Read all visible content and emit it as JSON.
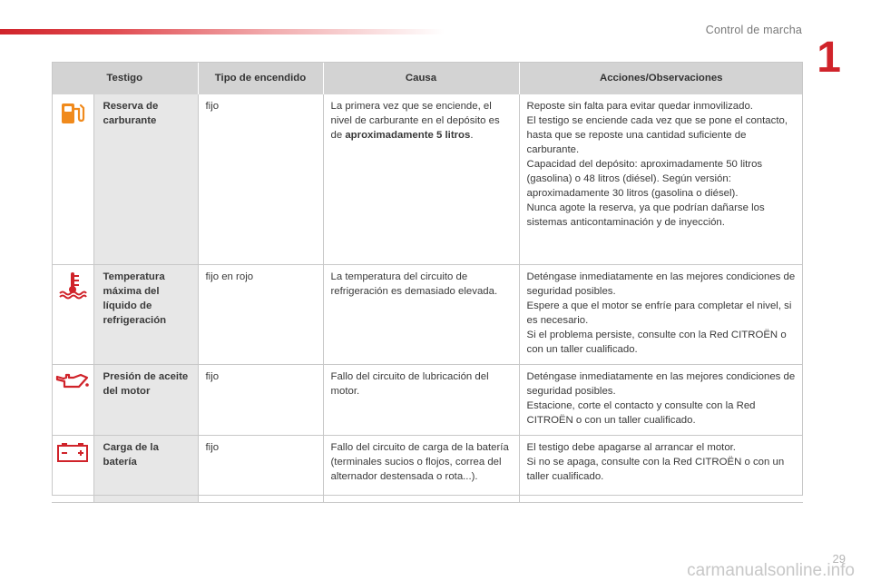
{
  "header": {
    "section_title": "Control de marcha",
    "chapter": "1"
  },
  "footer": {
    "page_number": "29",
    "watermark": "carmanualsonline.info"
  },
  "table": {
    "columns": [
      "Testigo",
      "Tipo de encendido",
      "Causa",
      "Acciones/Observaciones"
    ],
    "rows": [
      {
        "icon": "fuel-pump-icon",
        "name": "Reserva de carburante",
        "type": "fijo",
        "cause_pre": "La primera vez que se enciende, el nivel de carburante en el depósito es de ",
        "cause_bold": "aproximadamente 5 litros",
        "cause_post": ".",
        "actions": [
          "Reposte sin falta para evitar quedar inmovilizado.",
          "El testigo se enciende cada vez que se pone el contacto, hasta que se reposte una cantidad suficiente de carburante.",
          "Capacidad del depósito: aproximadamente 50 litros (gasolina) o 48 litros (diésel). Según versión: aproximadamente 30 litros (gasolina o diésel).",
          "Nunca agote la reserva, ya que podrían dañarse los sistemas anticontaminación y de inyección."
        ]
      },
      {
        "icon": "coolant-temperature-icon",
        "name": "Temperatura máxima del líquido de refrigeración",
        "type": "fijo en rojo",
        "cause": "La temperatura del circuito de refrigeración es demasiado elevada.",
        "actions": [
          "Deténgase inmediatamente en las mejores condiciones de seguridad posibles.",
          "Espere a que el motor se enfríe para completar el nivel, si es necesario.",
          "Si el problema persiste, consulte con la Red CITROËN o con un taller cualificado."
        ]
      },
      {
        "icon": "oil-can-icon",
        "name": "Presión de aceite del motor",
        "type": "fijo",
        "cause": "Fallo del circuito de lubricación del motor.",
        "actions": [
          "Deténgase inmediatamente en las mejores condiciones de seguridad posibles.",
          "Estacione, corte el contacto y consulte con la Red CITROËN o con un taller cualificado."
        ]
      },
      {
        "icon": "battery-icon",
        "name": "Carga de la batería",
        "type": "fijo",
        "cause": "Fallo del circuito de carga de la batería (terminales sucios o flojos, correa del alternador destensada o rota...).",
        "actions": [
          "El testigo debe apagarse al arrancar el motor.",
          "Si no se apaga, consulte con la Red CITROËN o con un taller cualificado."
        ]
      }
    ]
  },
  "colors": {
    "accent": "#d0232a",
    "header_bg": "#d3d3d3",
    "name_bg": "#e7e7e7"
  }
}
